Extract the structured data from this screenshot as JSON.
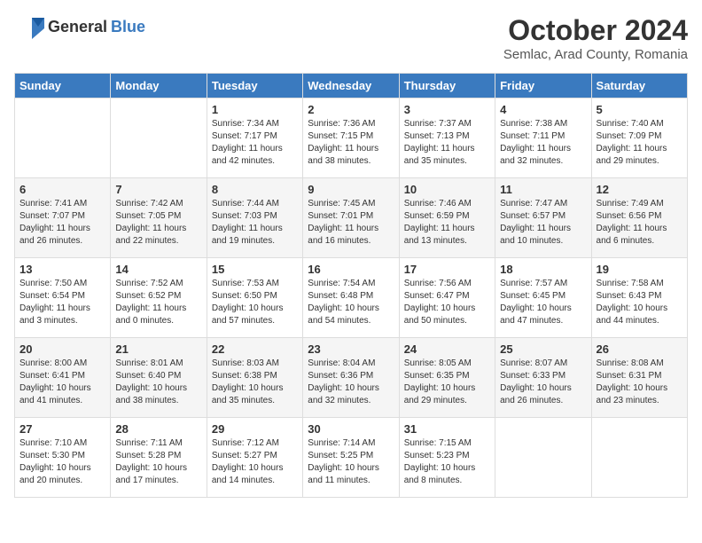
{
  "header": {
    "logo": {
      "general": "General",
      "blue": "Blue"
    },
    "title": "October 2024",
    "subtitle": "Semlac, Arad County, Romania"
  },
  "days_of_week": [
    "Sunday",
    "Monday",
    "Tuesday",
    "Wednesday",
    "Thursday",
    "Friday",
    "Saturday"
  ],
  "weeks": [
    [
      {
        "day": "",
        "info": ""
      },
      {
        "day": "",
        "info": ""
      },
      {
        "day": "1",
        "sunrise": "7:34 AM",
        "sunset": "7:17 PM",
        "daylight": "11 hours and 42 minutes."
      },
      {
        "day": "2",
        "sunrise": "7:36 AM",
        "sunset": "7:15 PM",
        "daylight": "11 hours and 38 minutes."
      },
      {
        "day": "3",
        "sunrise": "7:37 AM",
        "sunset": "7:13 PM",
        "daylight": "11 hours and 35 minutes."
      },
      {
        "day": "4",
        "sunrise": "7:38 AM",
        "sunset": "7:11 PM",
        "daylight": "11 hours and 32 minutes."
      },
      {
        "day": "5",
        "sunrise": "7:40 AM",
        "sunset": "7:09 PM",
        "daylight": "11 hours and 29 minutes."
      }
    ],
    [
      {
        "day": "6",
        "sunrise": "7:41 AM",
        "sunset": "7:07 PM",
        "daylight": "11 hours and 26 minutes."
      },
      {
        "day": "7",
        "sunrise": "7:42 AM",
        "sunset": "7:05 PM",
        "daylight": "11 hours and 22 minutes."
      },
      {
        "day": "8",
        "sunrise": "7:44 AM",
        "sunset": "7:03 PM",
        "daylight": "11 hours and 19 minutes."
      },
      {
        "day": "9",
        "sunrise": "7:45 AM",
        "sunset": "7:01 PM",
        "daylight": "11 hours and 16 minutes."
      },
      {
        "day": "10",
        "sunrise": "7:46 AM",
        "sunset": "6:59 PM",
        "daylight": "11 hours and 13 minutes."
      },
      {
        "day": "11",
        "sunrise": "7:47 AM",
        "sunset": "6:57 PM",
        "daylight": "11 hours and 10 minutes."
      },
      {
        "day": "12",
        "sunrise": "7:49 AM",
        "sunset": "6:56 PM",
        "daylight": "11 hours and 6 minutes."
      }
    ],
    [
      {
        "day": "13",
        "sunrise": "7:50 AM",
        "sunset": "6:54 PM",
        "daylight": "11 hours and 3 minutes."
      },
      {
        "day": "14",
        "sunrise": "7:52 AM",
        "sunset": "6:52 PM",
        "daylight": "11 hours and 0 minutes."
      },
      {
        "day": "15",
        "sunrise": "7:53 AM",
        "sunset": "6:50 PM",
        "daylight": "10 hours and 57 minutes."
      },
      {
        "day": "16",
        "sunrise": "7:54 AM",
        "sunset": "6:48 PM",
        "daylight": "10 hours and 54 minutes."
      },
      {
        "day": "17",
        "sunrise": "7:56 AM",
        "sunset": "6:47 PM",
        "daylight": "10 hours and 50 minutes."
      },
      {
        "day": "18",
        "sunrise": "7:57 AM",
        "sunset": "6:45 PM",
        "daylight": "10 hours and 47 minutes."
      },
      {
        "day": "19",
        "sunrise": "7:58 AM",
        "sunset": "6:43 PM",
        "daylight": "10 hours and 44 minutes."
      }
    ],
    [
      {
        "day": "20",
        "sunrise": "8:00 AM",
        "sunset": "6:41 PM",
        "daylight": "10 hours and 41 minutes."
      },
      {
        "day": "21",
        "sunrise": "8:01 AM",
        "sunset": "6:40 PM",
        "daylight": "10 hours and 38 minutes."
      },
      {
        "day": "22",
        "sunrise": "8:03 AM",
        "sunset": "6:38 PM",
        "daylight": "10 hours and 35 minutes."
      },
      {
        "day": "23",
        "sunrise": "8:04 AM",
        "sunset": "6:36 PM",
        "daylight": "10 hours and 32 minutes."
      },
      {
        "day": "24",
        "sunrise": "8:05 AM",
        "sunset": "6:35 PM",
        "daylight": "10 hours and 29 minutes."
      },
      {
        "day": "25",
        "sunrise": "8:07 AM",
        "sunset": "6:33 PM",
        "daylight": "10 hours and 26 minutes."
      },
      {
        "day": "26",
        "sunrise": "8:08 AM",
        "sunset": "6:31 PM",
        "daylight": "10 hours and 23 minutes."
      }
    ],
    [
      {
        "day": "27",
        "sunrise": "7:10 AM",
        "sunset": "5:30 PM",
        "daylight": "10 hours and 20 minutes."
      },
      {
        "day": "28",
        "sunrise": "7:11 AM",
        "sunset": "5:28 PM",
        "daylight": "10 hours and 17 minutes."
      },
      {
        "day": "29",
        "sunrise": "7:12 AM",
        "sunset": "5:27 PM",
        "daylight": "10 hours and 14 minutes."
      },
      {
        "day": "30",
        "sunrise": "7:14 AM",
        "sunset": "5:25 PM",
        "daylight": "10 hours and 11 minutes."
      },
      {
        "day": "31",
        "sunrise": "7:15 AM",
        "sunset": "5:23 PM",
        "daylight": "10 hours and 8 minutes."
      },
      {
        "day": "",
        "info": ""
      },
      {
        "day": "",
        "info": ""
      }
    ]
  ],
  "labels": {
    "sunrise": "Sunrise:",
    "sunset": "Sunset:",
    "daylight": "Daylight:"
  }
}
